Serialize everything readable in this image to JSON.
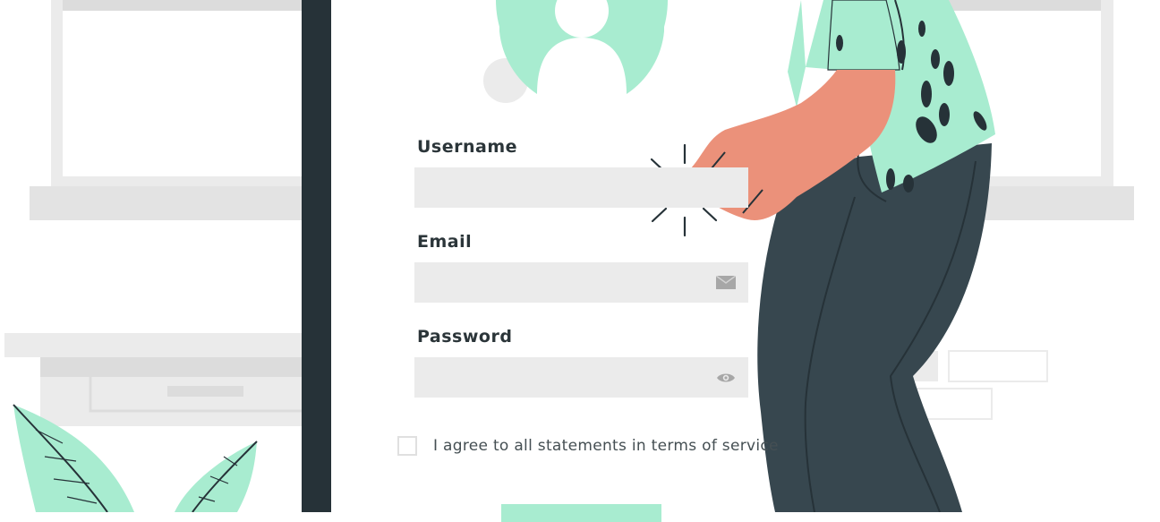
{
  "form": {
    "username_label": "Username",
    "username_value": "",
    "email_label": "Email",
    "email_value": "",
    "password_label": "Password",
    "password_value": "",
    "terms_label": "I agree to all statements in terms of service",
    "terms_checked": false
  },
  "icons": {
    "avatar": "user-avatar-icon",
    "email": "envelope-icon",
    "password": "eye-icon"
  },
  "colors": {
    "accent_mint": "#a8ecd0",
    "dark_pillar": "#263238",
    "field_bg": "#ebebeb",
    "skin": "#eb917a",
    "pants": "#37474f"
  }
}
